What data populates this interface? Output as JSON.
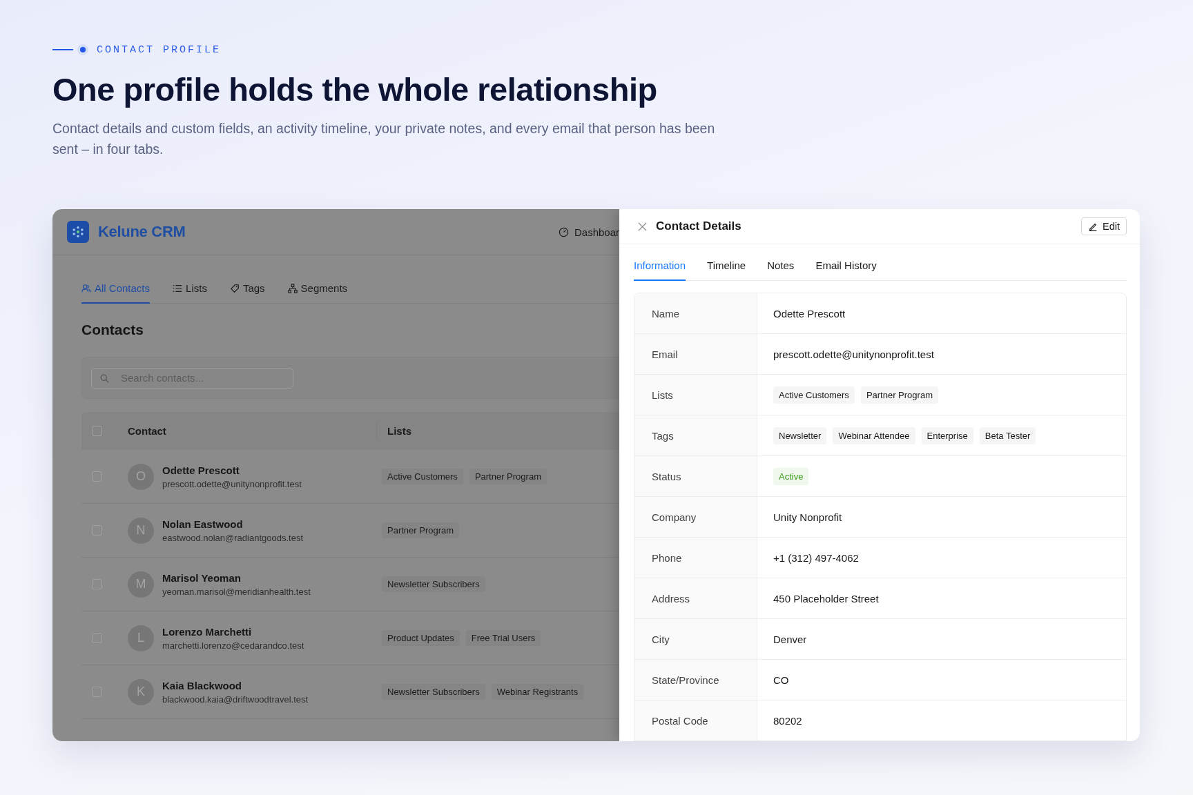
{
  "hero": {
    "eyebrow": "CONTACT PROFILE",
    "title": "One profile holds the whole relationship",
    "subtitle": "Contact details and custom fields, an activity timeline, your private notes, and every email that person has been sent – in four tabs."
  },
  "app": {
    "brand": "Kelune CRM",
    "nav": [
      {
        "label": "Dashboar"
      }
    ],
    "tabs": [
      {
        "label": "All Contacts",
        "selected": true
      },
      {
        "label": "Lists",
        "selected": false
      },
      {
        "label": "Tags",
        "selected": false
      },
      {
        "label": "Segments",
        "selected": false
      }
    ],
    "heading": "Contacts",
    "search": {
      "placeholder": "Search contacts..."
    },
    "table": {
      "select_all": {
        "checked": false
      },
      "columns": [
        "Contact",
        "Lists"
      ],
      "rows": [
        {
          "initial": "O",
          "name": "Odette Prescott",
          "email": "prescott.odette@unitynonprofit.test",
          "lists": [
            "Active Customers",
            "Partner Program"
          ],
          "checked": false
        },
        {
          "initial": "N",
          "name": "Nolan Eastwood",
          "email": "eastwood.nolan@radiantgoods.test",
          "lists": [
            "Partner Program"
          ],
          "checked": false
        },
        {
          "initial": "M",
          "name": "Marisol Yeoman",
          "email": "yeoman.marisol@meridianhealth.test",
          "lists": [
            "Newsletter Subscribers"
          ],
          "checked": false
        },
        {
          "initial": "L",
          "name": "Lorenzo Marchetti",
          "email": "marchetti.lorenzo@cedarandco.test",
          "lists": [
            "Product Updates",
            "Free Trial Users"
          ],
          "checked": false
        },
        {
          "initial": "K",
          "name": "Kaia Blackwood",
          "email": "blackwood.kaia@driftwoodtravel.test",
          "lists": [
            "Newsletter Subscribers",
            "Webinar Registrants"
          ],
          "checked": false
        }
      ]
    }
  },
  "panel": {
    "title": "Contact Details",
    "edit_button": "Edit",
    "tabs": [
      {
        "label": "Information",
        "selected": true
      },
      {
        "label": "Timeline",
        "selected": false
      },
      {
        "label": "Notes",
        "selected": false
      },
      {
        "label": "Email History",
        "selected": false
      }
    ],
    "fields": [
      {
        "label": "Name",
        "kind": "text",
        "value": "Odette Prescott"
      },
      {
        "label": "Email",
        "kind": "text",
        "value": "prescott.odette@unitynonprofit.test"
      },
      {
        "label": "Lists",
        "kind": "tags",
        "values": [
          "Active Customers",
          "Partner Program"
        ]
      },
      {
        "label": "Tags",
        "kind": "tags",
        "values": [
          "Newsletter",
          "Webinar Attendee",
          "Enterprise",
          "Beta Tester"
        ]
      },
      {
        "label": "Status",
        "kind": "status",
        "value": "Active",
        "color": "#3a9e1a"
      },
      {
        "label": "Company",
        "kind": "text",
        "value": "Unity Nonprofit"
      },
      {
        "label": "Phone",
        "kind": "text",
        "value": "+1 (312) 497-4062"
      },
      {
        "label": "Address",
        "kind": "text",
        "value": "450 Placeholder Street"
      },
      {
        "label": "City",
        "kind": "text",
        "value": "Denver"
      },
      {
        "label": "State/Province",
        "kind": "text",
        "value": "CO"
      },
      {
        "label": "Postal Code",
        "kind": "text",
        "value": "80202"
      }
    ]
  }
}
